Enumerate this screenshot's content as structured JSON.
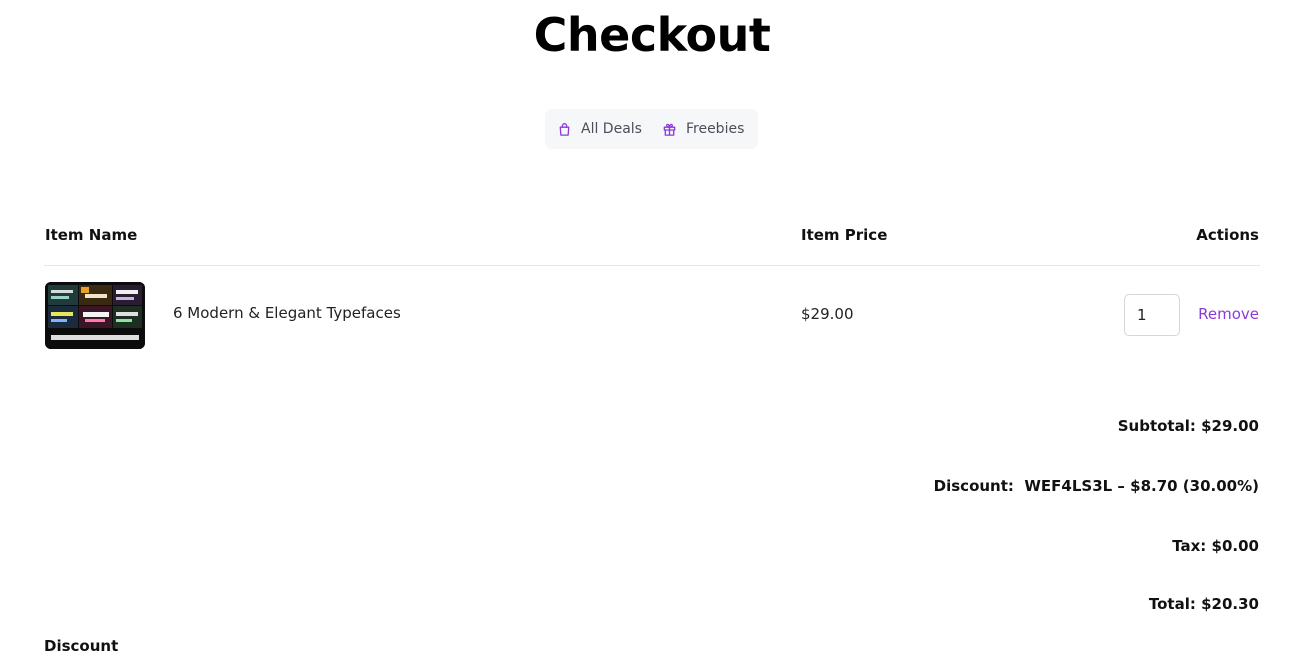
{
  "page": {
    "title": "Checkout"
  },
  "nav": {
    "items": [
      {
        "label": "All Deals",
        "icon": "shopping-bag-icon"
      },
      {
        "label": "Freebies",
        "icon": "gift-icon"
      }
    ],
    "accent_color": "#8a3bd8"
  },
  "table": {
    "headers": {
      "name": "Item Name",
      "price": "Item Price",
      "actions": "Actions"
    },
    "rows": [
      {
        "name": "6 Modern & Elegant Typefaces",
        "price": "$29.00",
        "quantity": "1",
        "remove_label": "Remove",
        "thumbnail_caption": "6 Modern & Elegant Typefaces"
      }
    ]
  },
  "summary": {
    "subtotal_label": "Subtotal:",
    "subtotal": "$29.00",
    "discount_label": "Discount:",
    "discount_value": "WEF4LS3L – $8.70 (30.00%)",
    "tax_label": "Tax:",
    "tax": "$0.00",
    "total_label": "Total:",
    "total": "$20.30"
  },
  "discount_section": {
    "heading": "Discount"
  }
}
